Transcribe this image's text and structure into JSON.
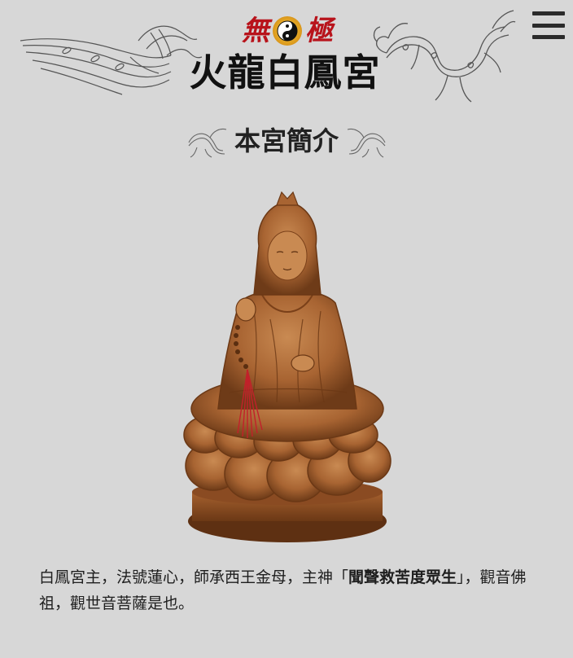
{
  "header": {
    "logo_top_left": "無",
    "logo_top_right": "極",
    "logo_title": "火龍白鳳宮",
    "menu_icon": "hamburger-menu-icon",
    "accent_color": "#b8131b"
  },
  "section": {
    "title": "本宮簡介"
  },
  "statue_image": {
    "icon": "guanyin-statue-image"
  },
  "description": {
    "part1": "白鳳宮主，法號蓮心，師承西王金母，主神「",
    "highlight": "聞聲救苦度眾生",
    "part2": "」，觀音佛祖，觀世音菩薩是也。"
  }
}
